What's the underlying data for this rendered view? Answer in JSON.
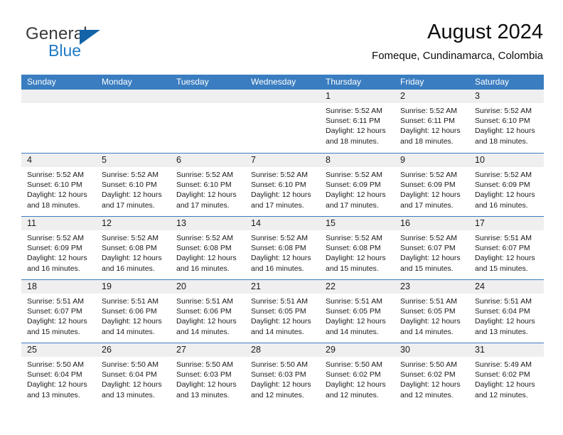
{
  "logo": {
    "word_top": "General",
    "word_bottom": "Blue"
  },
  "header": {
    "title": "August 2024",
    "location": "Fomeque, Cundinamarca, Colombia"
  },
  "weekdays": [
    "Sunday",
    "Monday",
    "Tuesday",
    "Wednesday",
    "Thursday",
    "Friday",
    "Saturday"
  ],
  "colors": {
    "header_blue": "#3a7dc0",
    "logo_blue": "#1f7ac4",
    "day_band_gray": "#efefef"
  },
  "weeks": [
    [
      {
        "day": ""
      },
      {
        "day": ""
      },
      {
        "day": ""
      },
      {
        "day": ""
      },
      {
        "day": "1",
        "sunrise": "Sunrise: 5:52 AM",
        "sunset": "Sunset: 6:11 PM",
        "daylight1": "Daylight: 12 hours",
        "daylight2": "and 18 minutes."
      },
      {
        "day": "2",
        "sunrise": "Sunrise: 5:52 AM",
        "sunset": "Sunset: 6:11 PM",
        "daylight1": "Daylight: 12 hours",
        "daylight2": "and 18 minutes."
      },
      {
        "day": "3",
        "sunrise": "Sunrise: 5:52 AM",
        "sunset": "Sunset: 6:10 PM",
        "daylight1": "Daylight: 12 hours",
        "daylight2": "and 18 minutes."
      }
    ],
    [
      {
        "day": "4",
        "sunrise": "Sunrise: 5:52 AM",
        "sunset": "Sunset: 6:10 PM",
        "daylight1": "Daylight: 12 hours",
        "daylight2": "and 18 minutes."
      },
      {
        "day": "5",
        "sunrise": "Sunrise: 5:52 AM",
        "sunset": "Sunset: 6:10 PM",
        "daylight1": "Daylight: 12 hours",
        "daylight2": "and 17 minutes."
      },
      {
        "day": "6",
        "sunrise": "Sunrise: 5:52 AM",
        "sunset": "Sunset: 6:10 PM",
        "daylight1": "Daylight: 12 hours",
        "daylight2": "and 17 minutes."
      },
      {
        "day": "7",
        "sunrise": "Sunrise: 5:52 AM",
        "sunset": "Sunset: 6:10 PM",
        "daylight1": "Daylight: 12 hours",
        "daylight2": "and 17 minutes."
      },
      {
        "day": "8",
        "sunrise": "Sunrise: 5:52 AM",
        "sunset": "Sunset: 6:09 PM",
        "daylight1": "Daylight: 12 hours",
        "daylight2": "and 17 minutes."
      },
      {
        "day": "9",
        "sunrise": "Sunrise: 5:52 AM",
        "sunset": "Sunset: 6:09 PM",
        "daylight1": "Daylight: 12 hours",
        "daylight2": "and 17 minutes."
      },
      {
        "day": "10",
        "sunrise": "Sunrise: 5:52 AM",
        "sunset": "Sunset: 6:09 PM",
        "daylight1": "Daylight: 12 hours",
        "daylight2": "and 16 minutes."
      }
    ],
    [
      {
        "day": "11",
        "sunrise": "Sunrise: 5:52 AM",
        "sunset": "Sunset: 6:09 PM",
        "daylight1": "Daylight: 12 hours",
        "daylight2": "and 16 minutes."
      },
      {
        "day": "12",
        "sunrise": "Sunrise: 5:52 AM",
        "sunset": "Sunset: 6:08 PM",
        "daylight1": "Daylight: 12 hours",
        "daylight2": "and 16 minutes."
      },
      {
        "day": "13",
        "sunrise": "Sunrise: 5:52 AM",
        "sunset": "Sunset: 6:08 PM",
        "daylight1": "Daylight: 12 hours",
        "daylight2": "and 16 minutes."
      },
      {
        "day": "14",
        "sunrise": "Sunrise: 5:52 AM",
        "sunset": "Sunset: 6:08 PM",
        "daylight1": "Daylight: 12 hours",
        "daylight2": "and 16 minutes."
      },
      {
        "day": "15",
        "sunrise": "Sunrise: 5:52 AM",
        "sunset": "Sunset: 6:08 PM",
        "daylight1": "Daylight: 12 hours",
        "daylight2": "and 15 minutes."
      },
      {
        "day": "16",
        "sunrise": "Sunrise: 5:52 AM",
        "sunset": "Sunset: 6:07 PM",
        "daylight1": "Daylight: 12 hours",
        "daylight2": "and 15 minutes."
      },
      {
        "day": "17",
        "sunrise": "Sunrise: 5:51 AM",
        "sunset": "Sunset: 6:07 PM",
        "daylight1": "Daylight: 12 hours",
        "daylight2": "and 15 minutes."
      }
    ],
    [
      {
        "day": "18",
        "sunrise": "Sunrise: 5:51 AM",
        "sunset": "Sunset: 6:07 PM",
        "daylight1": "Daylight: 12 hours",
        "daylight2": "and 15 minutes."
      },
      {
        "day": "19",
        "sunrise": "Sunrise: 5:51 AM",
        "sunset": "Sunset: 6:06 PM",
        "daylight1": "Daylight: 12 hours",
        "daylight2": "and 14 minutes."
      },
      {
        "day": "20",
        "sunrise": "Sunrise: 5:51 AM",
        "sunset": "Sunset: 6:06 PM",
        "daylight1": "Daylight: 12 hours",
        "daylight2": "and 14 minutes."
      },
      {
        "day": "21",
        "sunrise": "Sunrise: 5:51 AM",
        "sunset": "Sunset: 6:05 PM",
        "daylight1": "Daylight: 12 hours",
        "daylight2": "and 14 minutes."
      },
      {
        "day": "22",
        "sunrise": "Sunrise: 5:51 AM",
        "sunset": "Sunset: 6:05 PM",
        "daylight1": "Daylight: 12 hours",
        "daylight2": "and 14 minutes."
      },
      {
        "day": "23",
        "sunrise": "Sunrise: 5:51 AM",
        "sunset": "Sunset: 6:05 PM",
        "daylight1": "Daylight: 12 hours",
        "daylight2": "and 14 minutes."
      },
      {
        "day": "24",
        "sunrise": "Sunrise: 5:51 AM",
        "sunset": "Sunset: 6:04 PM",
        "daylight1": "Daylight: 12 hours",
        "daylight2": "and 13 minutes."
      }
    ],
    [
      {
        "day": "25",
        "sunrise": "Sunrise: 5:50 AM",
        "sunset": "Sunset: 6:04 PM",
        "daylight1": "Daylight: 12 hours",
        "daylight2": "and 13 minutes."
      },
      {
        "day": "26",
        "sunrise": "Sunrise: 5:50 AM",
        "sunset": "Sunset: 6:04 PM",
        "daylight1": "Daylight: 12 hours",
        "daylight2": "and 13 minutes."
      },
      {
        "day": "27",
        "sunrise": "Sunrise: 5:50 AM",
        "sunset": "Sunset: 6:03 PM",
        "daylight1": "Daylight: 12 hours",
        "daylight2": "and 13 minutes."
      },
      {
        "day": "28",
        "sunrise": "Sunrise: 5:50 AM",
        "sunset": "Sunset: 6:03 PM",
        "daylight1": "Daylight: 12 hours",
        "daylight2": "and 12 minutes."
      },
      {
        "day": "29",
        "sunrise": "Sunrise: 5:50 AM",
        "sunset": "Sunset: 6:02 PM",
        "daylight1": "Daylight: 12 hours",
        "daylight2": "and 12 minutes."
      },
      {
        "day": "30",
        "sunrise": "Sunrise: 5:50 AM",
        "sunset": "Sunset: 6:02 PM",
        "daylight1": "Daylight: 12 hours",
        "daylight2": "and 12 minutes."
      },
      {
        "day": "31",
        "sunrise": "Sunrise: 5:49 AM",
        "sunset": "Sunset: 6:02 PM",
        "daylight1": "Daylight: 12 hours",
        "daylight2": "and 12 minutes."
      }
    ]
  ]
}
